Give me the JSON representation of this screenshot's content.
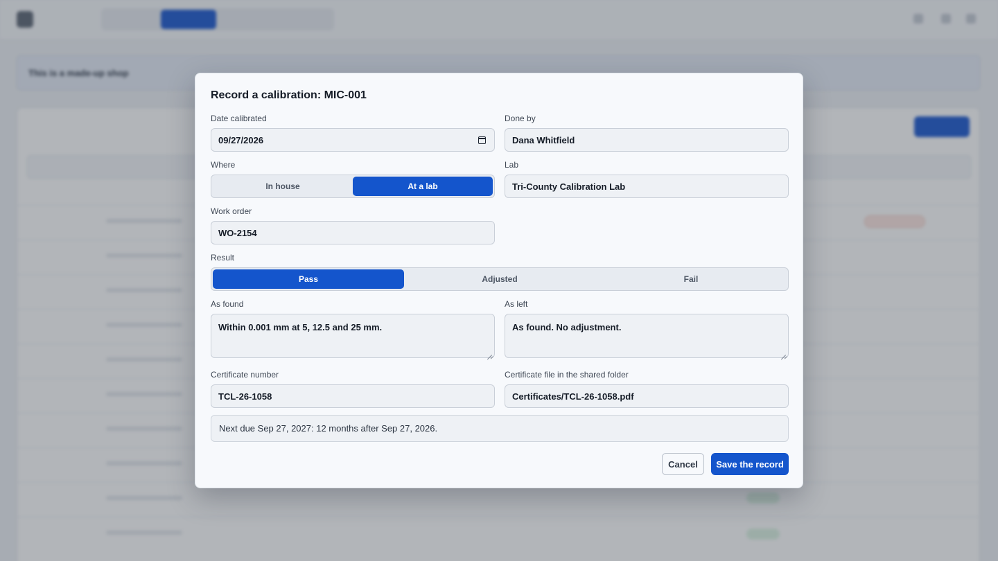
{
  "modal": {
    "title": "Record a calibration: MIC-001",
    "date_label": "Date calibrated",
    "date_value": "09/27/2026",
    "done_by_label": "Done by",
    "done_by_value": "Dana Whitfield",
    "where_label": "Where",
    "where_options": [
      "In house",
      "At a lab"
    ],
    "where_selected": "At a lab",
    "lab_label": "Lab",
    "lab_value": "Tri-County Calibration Lab",
    "work_order_label": "Work order",
    "work_order_value": "WO-2154",
    "result_label": "Result",
    "result_options": [
      "Pass",
      "Adjusted",
      "Fail"
    ],
    "result_selected": "Pass",
    "as_found_label": "As found",
    "as_found_value": "Within 0.001 mm at 5, 12.5 and 25 mm.",
    "as_left_label": "As left",
    "as_left_value": "As found. No adjustment.",
    "cert_number_label": "Certificate number",
    "cert_number_value": "TCL-26-1058",
    "cert_file_label": "Certificate file in the shared folder",
    "cert_file_value": "Certificates/TCL-26-1058.pdf",
    "next_due_text": "Next due Sep 27, 2027: 12 months after Sep 27, 2026.",
    "cancel_label": "Cancel",
    "save_label": "Save the record"
  },
  "background": {
    "notice_text": "This is a made-up shop"
  },
  "colors": {
    "accent": "#1455cc",
    "overlay": "#343c48"
  }
}
